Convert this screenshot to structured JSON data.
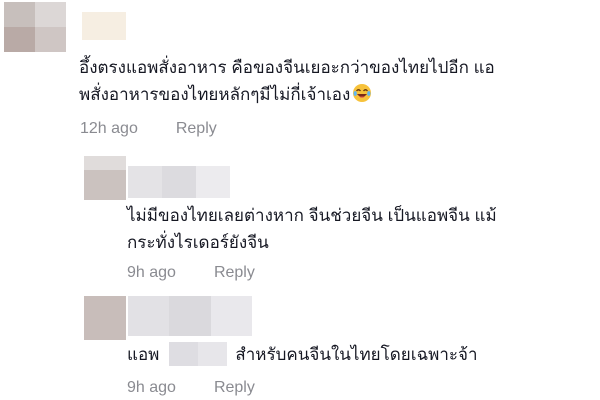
{
  "comments": [
    {
      "text_line1": "อึ้งตรงแอพสั่งอาหาร คือของจีนเยอะกว่าของไทยไปอีก แอ",
      "text_line2": "พสั่งอาหารของไทยหลักๆมีไม่กี่เจ้าเอง",
      "emoji": "laughing-crying-emoji",
      "time": "12h ago",
      "reply_label": "Reply"
    },
    {
      "text_line1": "ไม่มีของไทยเลยต่างหาก จีนช่วยจีน เป็นแอพจีน แม้",
      "text_line2": "กระทั่งไรเดอร์ยังจีน",
      "time": "9h ago",
      "reply_label": "Reply"
    },
    {
      "text_before_mention": "แอพ",
      "text_after_mention": "สำหรับคนจีนในไทยโดยเฉพาะจ้า",
      "time": "9h ago",
      "reply_label": "Reply"
    }
  ],
  "colors": {
    "text": "#161823",
    "meta": "#8a8b91",
    "background": "#ffffff"
  }
}
